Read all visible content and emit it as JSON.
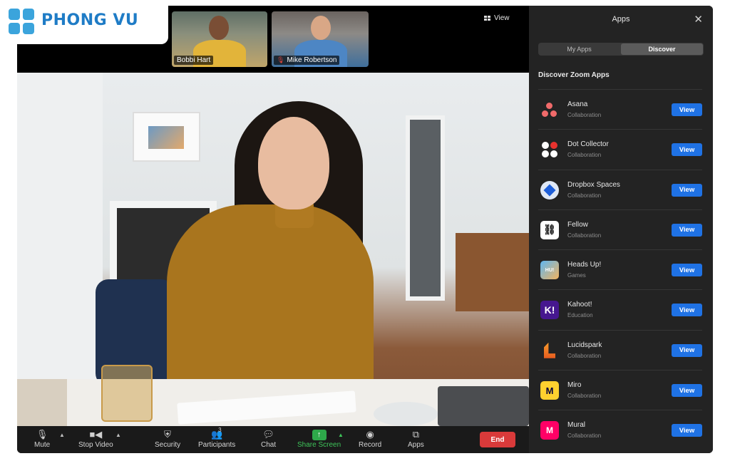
{
  "logo": {
    "text": "PHONG VU"
  },
  "top_strip": {
    "participants": [
      {
        "name": "Bobbi Hart",
        "muted": false
      },
      {
        "name": "Mike Robertson",
        "muted": true
      }
    ],
    "view_label": "View"
  },
  "toolbar": {
    "mute": "Mute",
    "stop_video": "Stop Video",
    "security": "Security",
    "participants": "Participants",
    "participants_count": "3",
    "chat": "Chat",
    "share_screen": "Share Screen",
    "record": "Record",
    "apps": "Apps",
    "end": "End"
  },
  "panel": {
    "title": "Apps",
    "tabs": [
      "My Apps",
      "Discover"
    ],
    "active_tab": "Discover",
    "section_title": "Discover Zoom Apps",
    "view_label": "View",
    "apps": [
      {
        "name": "Asana",
        "category": "Collaboration",
        "icon": "asana-icon"
      },
      {
        "name": "Dot Collector",
        "category": "Collaboration",
        "icon": "dot-collector-icon"
      },
      {
        "name": "Dropbox Spaces",
        "category": "Collaboration",
        "icon": "dropbox-icon"
      },
      {
        "name": "Fellow",
        "category": "Collaboration",
        "icon": "fellow-icon"
      },
      {
        "name": "Heads Up!",
        "category": "Games",
        "icon": "heads-up-icon"
      },
      {
        "name": "Kahoot!",
        "category": "Education",
        "icon": "kahoot-icon"
      },
      {
        "name": "Lucidspark",
        "category": "Collaboration",
        "icon": "lucidspark-icon"
      },
      {
        "name": "Miro",
        "category": "Collaboration",
        "icon": "miro-icon"
      },
      {
        "name": "Mural",
        "category": "Collaboration",
        "icon": "mural-icon"
      }
    ]
  },
  "colors": {
    "view_button": "#1f72e5",
    "end_button": "#d93a3a",
    "share_green": "#3ec55a",
    "panel_bg": "#232323"
  }
}
